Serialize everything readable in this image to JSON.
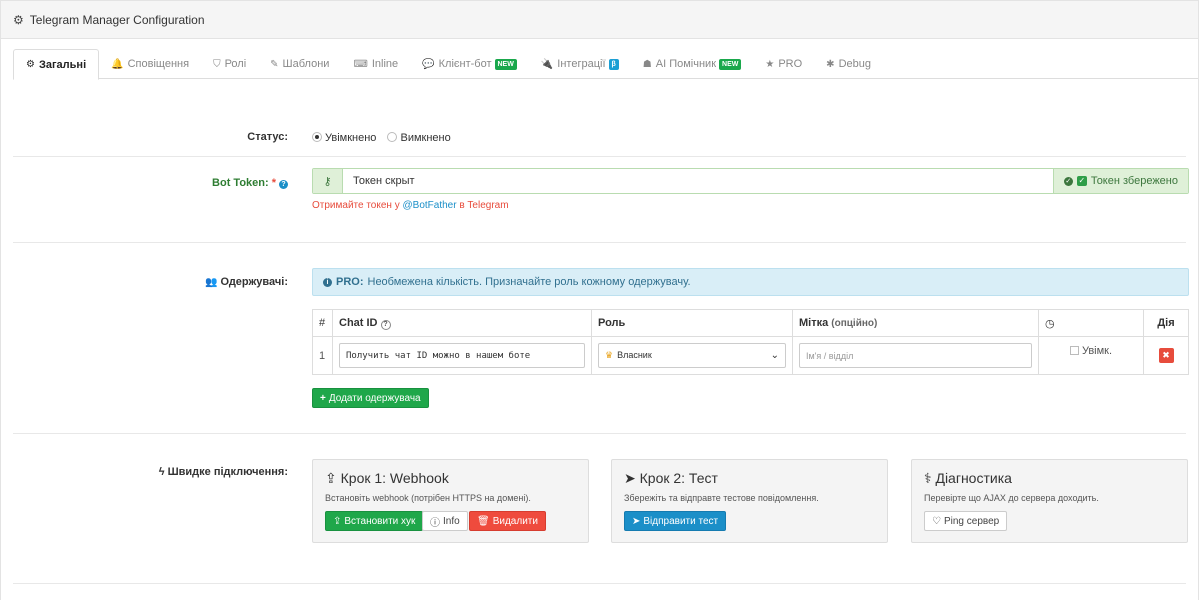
{
  "panel": {
    "title": "Telegram Manager Configuration",
    "icon": "gear-icon"
  },
  "tabs": [
    {
      "label": "Загальні",
      "icon": "gear-icon",
      "glyph": "⚙",
      "active": true,
      "badge": ""
    },
    {
      "label": "Сповіщення",
      "icon": "bell-icon",
      "glyph": "🔔",
      "active": false,
      "badge": ""
    },
    {
      "label": "Ролі",
      "icon": "shield-icon",
      "glyph": "⛉",
      "active": false,
      "badge": ""
    },
    {
      "label": "Шаблони",
      "icon": "edit-icon",
      "glyph": "✎",
      "active": false,
      "badge": ""
    },
    {
      "label": "Inline",
      "icon": "keyboard-icon",
      "glyph": "⌨",
      "active": false,
      "badge": ""
    },
    {
      "label": "Клієнт-бот",
      "icon": "chat-icon",
      "glyph": "💬",
      "active": false,
      "badge": "NEW"
    },
    {
      "label": "Інтеграції",
      "icon": "plug-icon",
      "glyph": "🔌",
      "active": false,
      "badge": "β"
    },
    {
      "label": "AI Помічник",
      "icon": "android-icon",
      "glyph": "☗",
      "active": false,
      "badge": "NEW"
    },
    {
      "label": "PRO",
      "icon": "star-icon",
      "glyph": "★",
      "active": false,
      "badge": ""
    },
    {
      "label": "Debug",
      "icon": "bug-icon",
      "glyph": "✱",
      "active": false,
      "badge": ""
    }
  ],
  "status": {
    "label": "Статус:",
    "options": [
      {
        "label": "Увімкнено",
        "checked": true
      },
      {
        "label": "Вимкнено",
        "checked": false
      }
    ]
  },
  "token": {
    "label": "Bot Token:",
    "required_mark": "*",
    "value": "Токен скрыт",
    "saved_label": "Токен збережено",
    "hint_prefix": "Отримайте токен у",
    "hint_link": "@BotFather",
    "hint_suffix": "в Telegram"
  },
  "recipients": {
    "label": "Одержувачі:",
    "info_strong": "PRO:",
    "info_text": "Необмежена кількість. Призначайте роль кожному одержувачу.",
    "columns": {
      "num": "#",
      "chat_id": "Chat ID",
      "role": "Роль",
      "tag": "Мітка",
      "tag_sub": "(опційно)",
      "action": "Дія"
    },
    "rows": [
      {
        "num": "1",
        "chat_id": "Получить чат ID можно в нашем боте",
        "role": "Власник",
        "tag_placeholder": "Ім'я / відділ",
        "enabled_label": "Увімк.",
        "enabled": false
      }
    ],
    "add_button": "Додати одержувача"
  },
  "quick": {
    "label": "Швидке підключення:",
    "cards": [
      {
        "title": "Крок 1: Webhook",
        "desc": "Встановіть webhook (потрібен HTTPS на домені).",
        "buttons": [
          "Встановити хук",
          "Info",
          "Видалити"
        ]
      },
      {
        "title": "Крок 2: Тест",
        "desc": "Збережіть та відправте тестове повідомлення.",
        "buttons": [
          "Відправити тест"
        ]
      },
      {
        "title": "Діагностика",
        "desc": "Перевірте що AJAX до сервера доходить.",
        "buttons": [
          "Ping сервер"
        ]
      }
    ]
  },
  "colors": {
    "success": "#1fa74a",
    "danger": "#ef4b3d",
    "primary": "#1b8fc8",
    "info_bg": "#d9eef7"
  }
}
